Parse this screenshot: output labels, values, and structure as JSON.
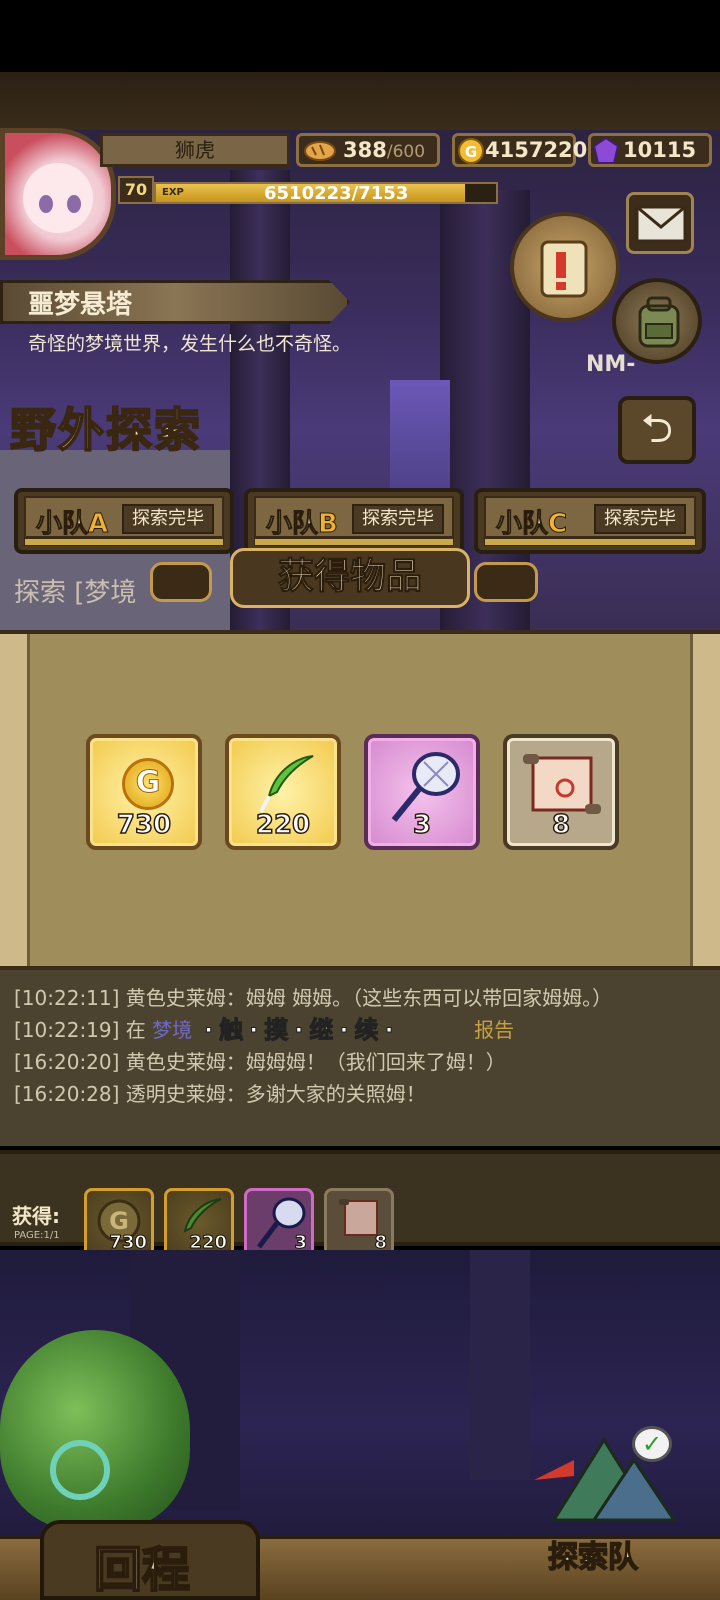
{
  "player": {
    "name": "狮虎",
    "level": "70",
    "exp_label": "EXP",
    "exp_text": "6510223/7153",
    "exp_fraction": 0.91
  },
  "resources": {
    "stamina_current": "388",
    "stamina_max": "/600",
    "gold": "4157220",
    "gems": "10115"
  },
  "area": {
    "name": "噩梦悬塔",
    "description": "奇怪的梦境世界，发生什么也不奇怪。",
    "mode_title": "野外探索",
    "stage_label": "NM-"
  },
  "teams": [
    {
      "name_prefix": "小队",
      "letter": "A",
      "status": "探索完毕"
    },
    {
      "name_prefix": "小队",
      "letter": "B",
      "status": "探索完毕"
    },
    {
      "name_prefix": "小队",
      "letter": "C",
      "status": "探索完毕"
    }
  ],
  "explore_text": "探索 [梦境",
  "popup": {
    "title": "获得物品",
    "rewards": [
      {
        "icon": "gold-coin-icon",
        "qty": "730",
        "rarity": "gold"
      },
      {
        "icon": "green-feather-icon",
        "qty": "220",
        "rarity": "gold"
      },
      {
        "icon": "bug-net-icon",
        "qty": "3",
        "rarity": "purple"
      },
      {
        "icon": "scroll-map-icon",
        "qty": "8",
        "rarity": "plain"
      }
    ]
  },
  "log": {
    "lines": [
      {
        "time": "[10:22:11]",
        "text": "黄色史莱姆：姆姆 姆姆。（这些东西可以带回家姆姆。）"
      },
      {
        "time": "[10:22:19]",
        "prefix": "在 ",
        "place": "梦境",
        "suffix": "报告"
      },
      {
        "time": "[16:20:20]",
        "text": "黄色史莱姆：姆姆姆！（我们回来了姆！）"
      },
      {
        "time": "[16:20:28]",
        "text": "透明史莱姆：多谢大家的关照姆！"
      }
    ],
    "touch_continue": "·触·摸·继·续·"
  },
  "obtained": {
    "label": "获得:",
    "page": "PAGE:1/1",
    "items": [
      {
        "icon": "gold-coin-icon",
        "qty": "730"
      },
      {
        "icon": "green-feather-icon",
        "qty": "220"
      },
      {
        "icon": "bug-net-icon",
        "qty": "3"
      },
      {
        "icon": "scroll-map-icon",
        "qty": "8"
      }
    ]
  },
  "bottom": {
    "return_label": "回程",
    "team_label": "探索队"
  },
  "colors": {
    "gold_frame": "#f2c94c",
    "purple_frame": "#d489cf",
    "panel_brown": "#4b3a22"
  }
}
